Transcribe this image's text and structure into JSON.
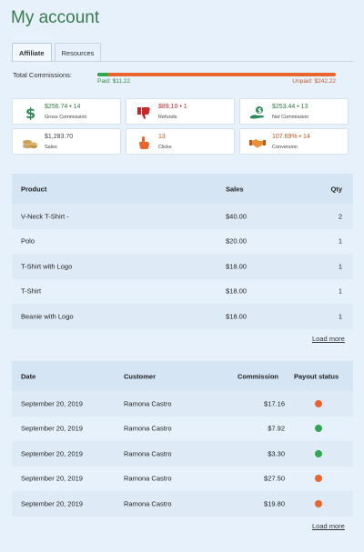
{
  "page": {
    "title": "My account"
  },
  "tabs": [
    {
      "label": "Affiliate",
      "active": true
    },
    {
      "label": "Resources",
      "active": false
    }
  ],
  "commissions": {
    "label": "Total Commissions:",
    "paid_label": "Paid: $11.22",
    "unpaid_label": "Unpaid: $242.22",
    "paid_fraction": 0.044,
    "colors": {
      "paid": "#2fa84f",
      "unpaid": "#e8652f"
    }
  },
  "stats": [
    {
      "value": "$256.74 • 14",
      "label": "Gross Commission",
      "icon": "dollar-icon",
      "tone": "g"
    },
    {
      "value": "$89.10 • 1",
      "label": "Refunds",
      "icon": "thumbs-down-icon",
      "tone": "r"
    },
    {
      "value": "$253.44 • 13",
      "label": "Net Commission",
      "icon": "hand-money-icon",
      "tone": "g"
    },
    {
      "value": "$1,283.70",
      "label": "Sales",
      "icon": "coins-icon",
      "tone": "k"
    },
    {
      "value": "13",
      "label": "Clicks",
      "icon": "pointer-hand-icon",
      "tone": "o"
    },
    {
      "value": "107.69% • 14",
      "label": "Conversion",
      "icon": "handshake-icon",
      "tone": "o"
    }
  ],
  "products": {
    "headers": [
      "Product",
      "Sales",
      "Qty"
    ],
    "rows": [
      [
        "V-Neck T-Shirt -",
        "$40.00",
        "2"
      ],
      [
        "Polo",
        "$20.00",
        "1"
      ],
      [
        "T-Shirt with Logo",
        "$18.00",
        "1"
      ],
      [
        "T-Shirt",
        "$18.00",
        "1"
      ],
      [
        "Beanie with Logo",
        "$18.00",
        "1"
      ]
    ],
    "load_more": "Load more"
  },
  "referrals": {
    "headers": [
      "Date",
      "Customer",
      "Commission",
      "Payout status"
    ],
    "rows": [
      [
        "September 20, 2019",
        "Ramona Castro",
        "$17.16",
        "unpaid"
      ],
      [
        "September 20, 2019",
        "Ramona Castro",
        "$7.92",
        "paid"
      ],
      [
        "September 20, 2019",
        "Ramona Castro",
        "$3.30",
        "paid"
      ],
      [
        "September 20, 2019",
        "Ramona Castro",
        "$27.50",
        "unpaid"
      ],
      [
        "September 20, 2019",
        "Ramona Castro",
        "$19.80",
        "unpaid"
      ]
    ],
    "status_colors": {
      "paid": "#2fa84f",
      "unpaid": "#e8652f"
    },
    "load_more": "Load more"
  }
}
